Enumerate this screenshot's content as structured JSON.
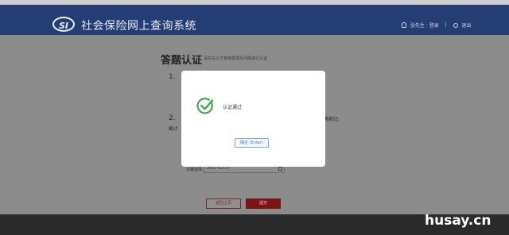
{
  "header": {
    "logo_text": "SI",
    "title": "社会保险网上查询系统",
    "user_label": "张先生 · 登录",
    "separator": "|",
    "logout_label": "退出"
  },
  "main": {
    "heading": "答题认证",
    "subheading": "请先在以下答题框填写问题进行认证",
    "question1": "1.",
    "question2": "2.",
    "question2_tail": "截止",
    "question2_right": "期和比",
    "date_label": "日期选择：",
    "date_value": "2017-02-27",
    "prev_button": "返回上页",
    "submit_button": "提交"
  },
  "modal": {
    "message": "认证通过",
    "ok_button": "确定 (Enter)"
  },
  "watermark": "husay.cn",
  "colors": {
    "header_bg": "#243d72",
    "overlay": "#8c8c8c",
    "success_green": "#3aa84a",
    "submit_red": "#7a1515"
  }
}
